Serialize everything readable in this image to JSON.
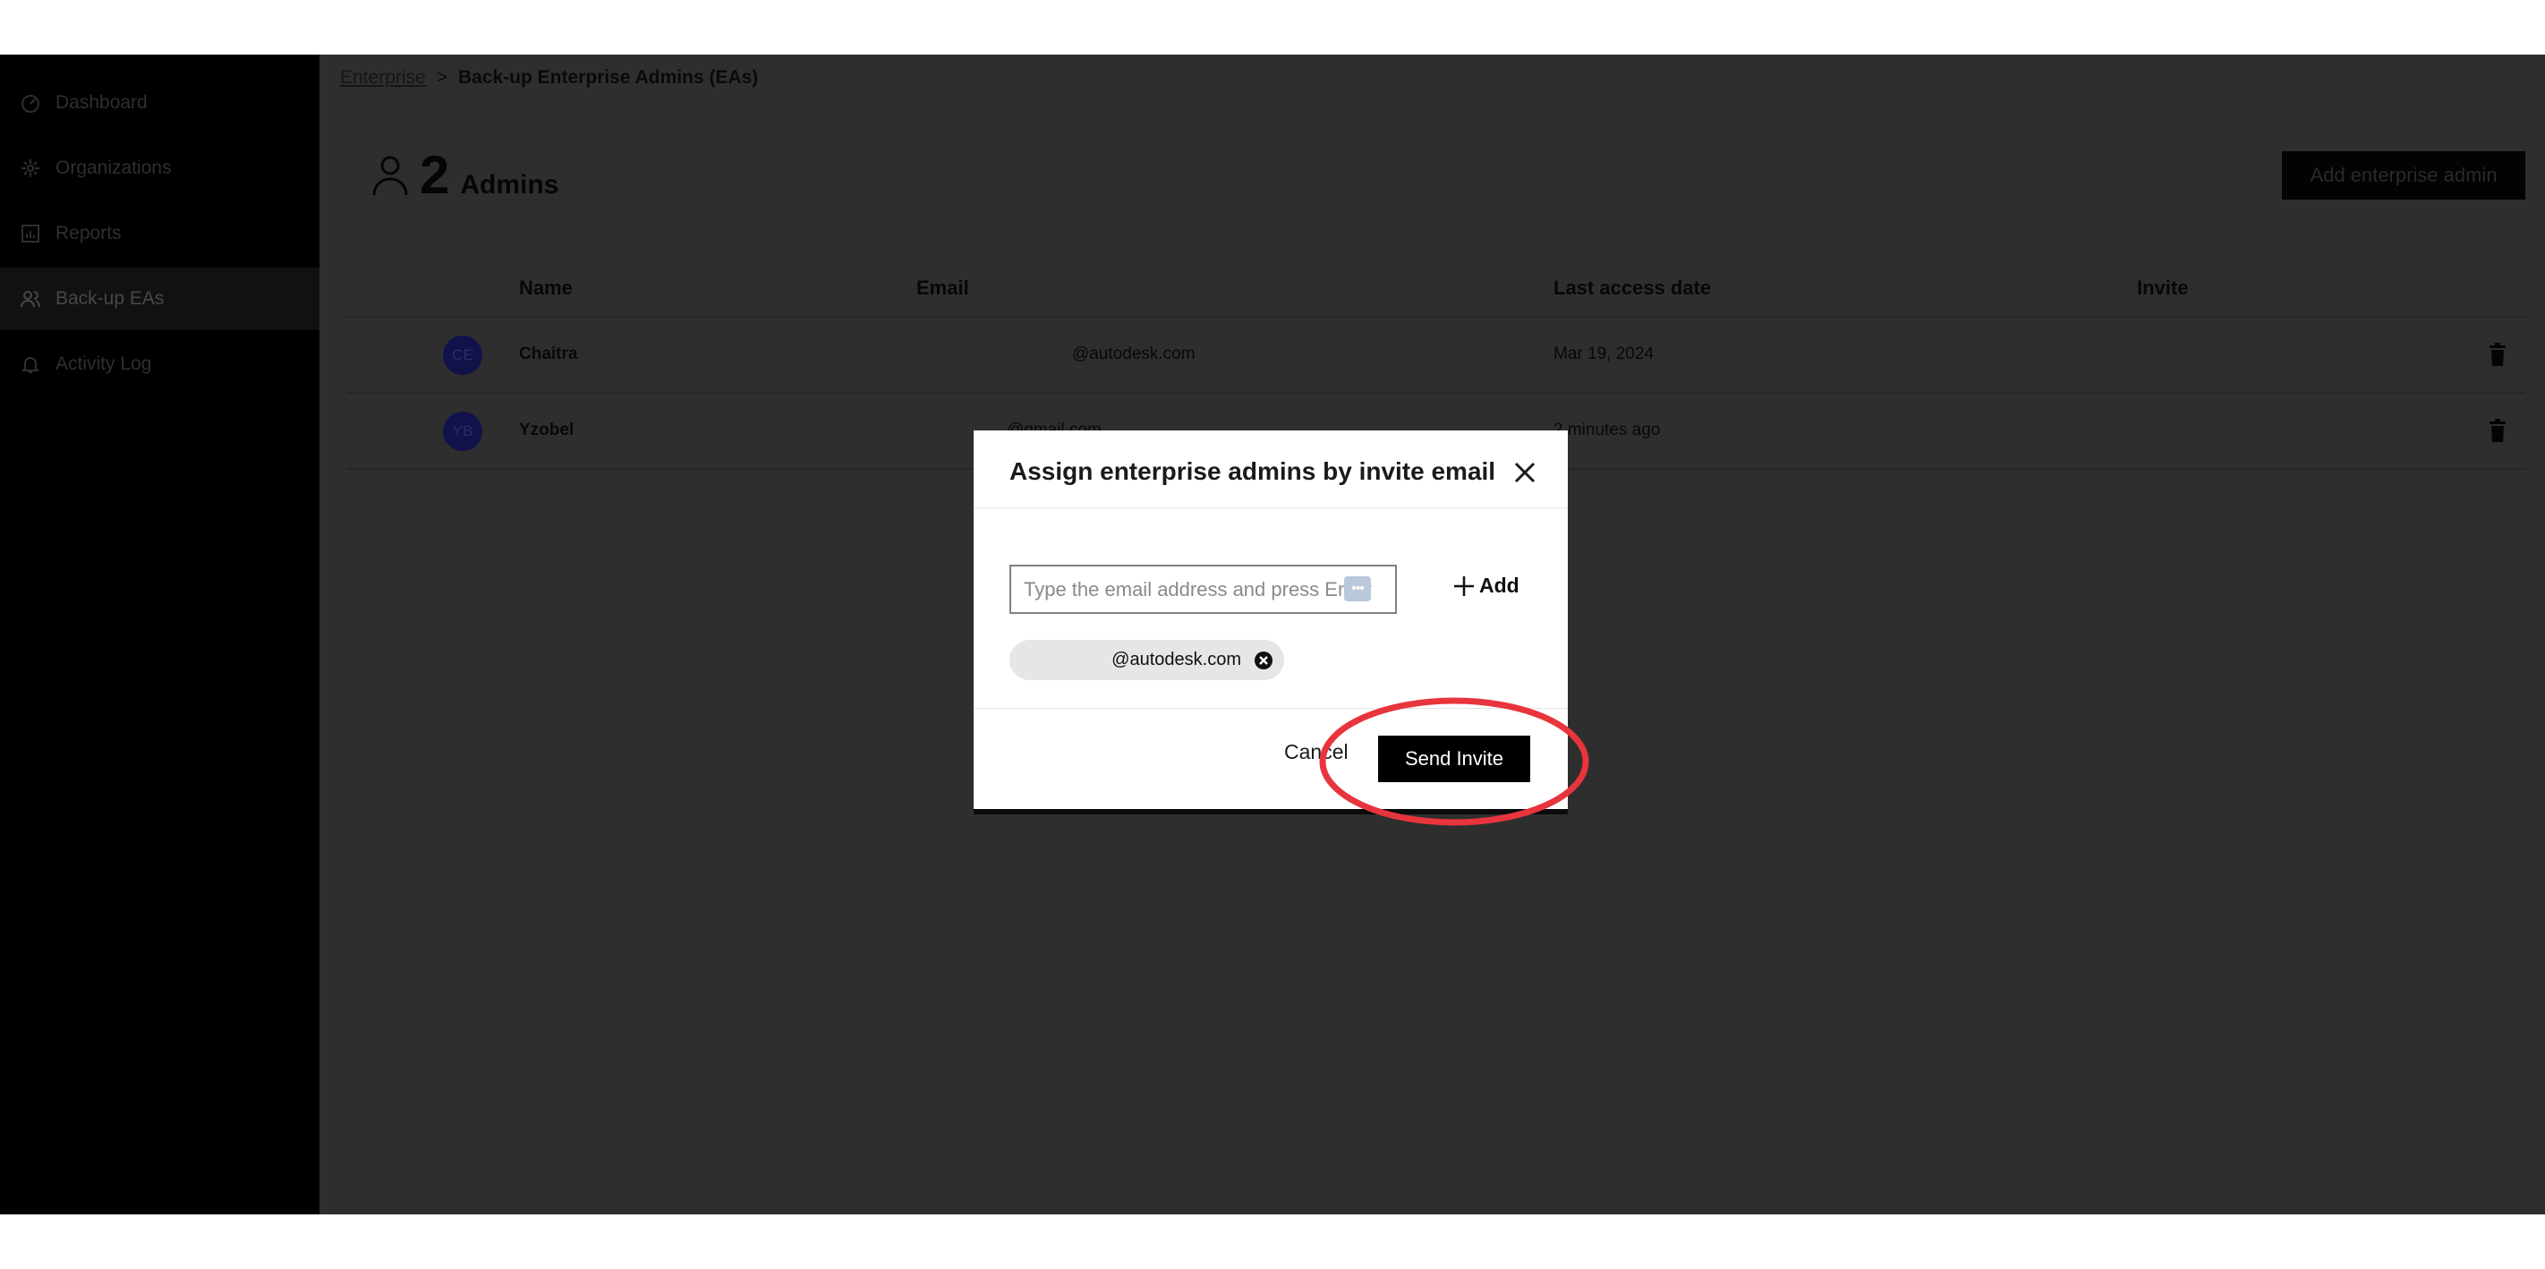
{
  "sidebar": {
    "items": [
      {
        "label": "Dashboard",
        "icon": "dashboard-icon"
      },
      {
        "label": "Organizations",
        "icon": "organizations-icon"
      },
      {
        "label": "Reports",
        "icon": "reports-icon"
      },
      {
        "label": "Back-up EAs",
        "icon": "users-icon",
        "active": true
      },
      {
        "label": "Activity Log",
        "icon": "bell-icon"
      }
    ]
  },
  "breadcrumb": {
    "root": "Enterprise",
    "separator": ">",
    "current": "Back-up Enterprise Admins (EAs)"
  },
  "summary": {
    "count": "2",
    "label": "Admins"
  },
  "actions": {
    "add_admin": "Add enterprise admin"
  },
  "table": {
    "headers": {
      "name": "Name",
      "email": "Email",
      "last_access": "Last access date",
      "invite": "Invite"
    },
    "rows": [
      {
        "initials": "CE",
        "name": "Chaitra",
        "email": "@autodesk.com",
        "last_access": "Mar 19, 2024"
      },
      {
        "initials": "YB",
        "name": "Yzobel",
        "email": "@gmail.com",
        "last_access": "2 minutes ago"
      }
    ]
  },
  "modal": {
    "title": "Assign enterprise admins by invite email",
    "email_placeholder": "Type the email address and press Enter",
    "add_label": "Add",
    "chip_email": "@autodesk.com",
    "cancel_label": "Cancel",
    "send_label": "Send Invite"
  },
  "colors": {
    "accent": "#000000",
    "highlight_ring": "#e8343c",
    "avatar": "#12124a"
  }
}
